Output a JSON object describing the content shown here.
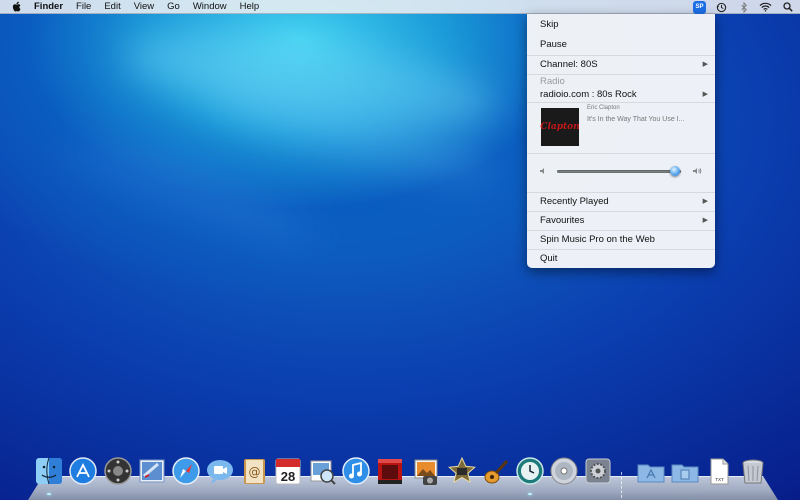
{
  "menubar": {
    "app_name": "Finder",
    "menus": [
      "File",
      "Edit",
      "View",
      "Go",
      "Window",
      "Help"
    ],
    "status_icons": [
      "spin-music-icon",
      "time-machine-icon",
      "bluetooth-icon",
      "wifi-icon",
      "spotlight-icon"
    ],
    "spin_icon_text": "SP"
  },
  "dropdown": {
    "skip": "Skip",
    "pause": "Pause",
    "channel": "Channel: 80S",
    "radio_label": "Radio",
    "station": "radioio.com : 80s Rock",
    "now_playing": {
      "artist": "Eric Clapton",
      "track": "It's In the Way That You Use I...",
      "art_text": "Clapton"
    },
    "volume_fraction": 0.95,
    "recently_played": "Recently Played",
    "favourites": "Favourites",
    "web": "Spin Music Pro on the Web",
    "quit": "Quit"
  },
  "dock": {
    "calendar_day": "28",
    "document_label": "TXT",
    "apps": [
      "finder",
      "app-store",
      "launchpad",
      "mail",
      "safari",
      "facetime",
      "address-book",
      "ical",
      "preview",
      "itunes",
      "photo-booth",
      "iphoto",
      "imovie",
      "garageband",
      "time-machine",
      "dvd-player",
      "system-preferences"
    ],
    "stacks": [
      "applications-folder",
      "documents-folder",
      "text-document",
      "trash"
    ]
  }
}
